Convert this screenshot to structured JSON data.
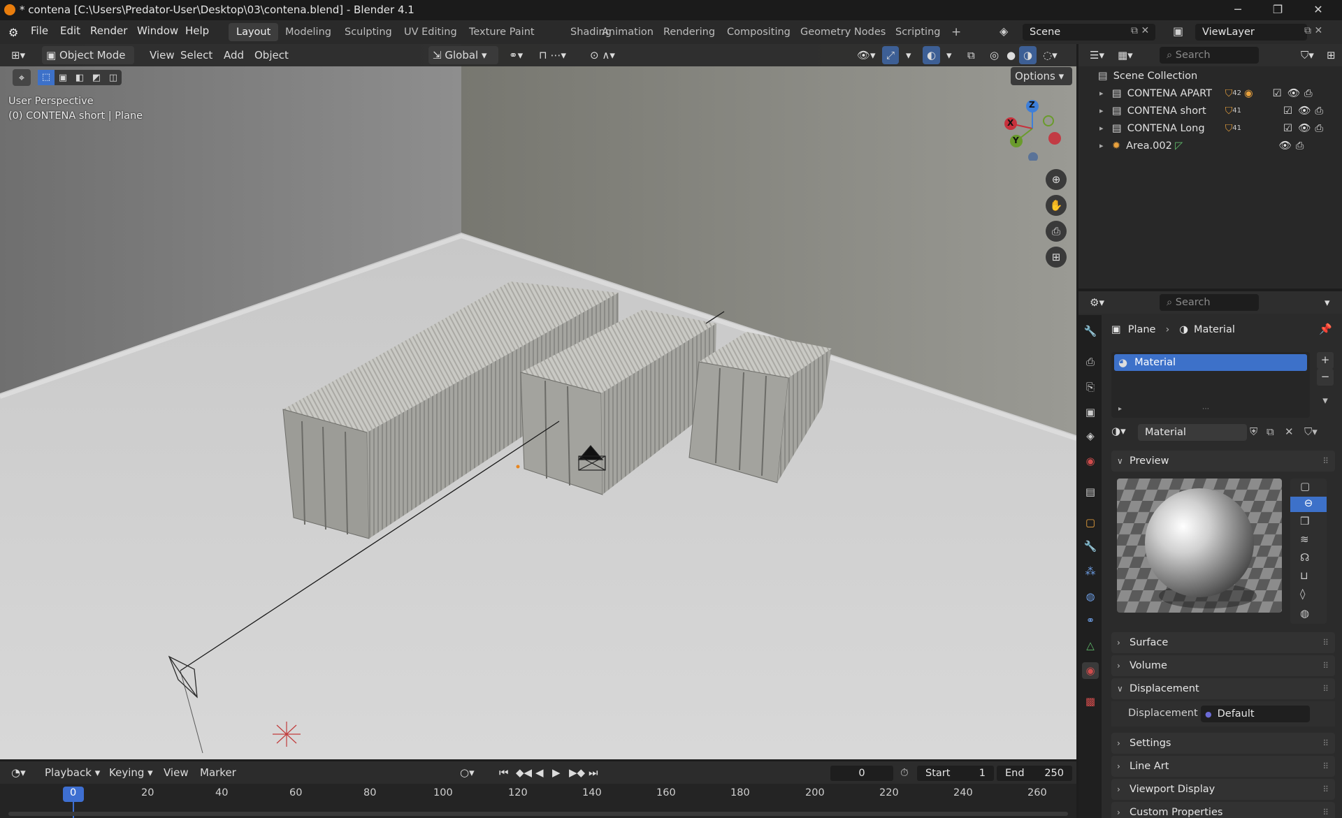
{
  "window": {
    "title": "* contena [C:\\Users\\Predator-User\\Desktop\\03\\contena.blend] - Blender 4.1",
    "minimize": "─",
    "maximize": "❐",
    "close": "✕"
  },
  "menu": {
    "items": [
      "File",
      "Edit",
      "Render",
      "Window",
      "Help"
    ],
    "workspaces": [
      "Layout",
      "Modeling",
      "Sculpting",
      "UV Editing",
      "Texture Paint",
      "Shading",
      "Animation",
      "Rendering",
      "Compositing",
      "Geometry Nodes",
      "Scripting"
    ],
    "active_workspace": "Layout",
    "add_workspace": "+",
    "scene_name": "Scene",
    "view_layer": "ViewLayer"
  },
  "viewport": {
    "mode": "Object Mode",
    "menus": [
      "View",
      "Select",
      "Add",
      "Object"
    ],
    "orientation": "Global",
    "options": "Options",
    "info_line1": "User Perspective",
    "info_line2": "(0) CONTENA short | Plane",
    "gizmo": {
      "z": "Z",
      "x": "X",
      "y": "Y"
    }
  },
  "outliner": {
    "search_placeholder": "Search",
    "root": "Scene Collection",
    "items": [
      {
        "name": "CONTENA APART",
        "badge": "42"
      },
      {
        "name": "CONTENA short",
        "badge": "41"
      },
      {
        "name": "CONTENA Long",
        "badge": "41"
      },
      {
        "name": "Area.002",
        "badge": ""
      }
    ]
  },
  "properties": {
    "search_placeholder": "Search",
    "breadcrumb_object": "Plane",
    "breadcrumb_data": "Material",
    "slot_name": "Material",
    "material_name": "Material",
    "panels": {
      "preview": "Preview",
      "surface": "Surface",
      "volume": "Volume",
      "displacement": "Displacement",
      "displacement_label": "Displacement",
      "displacement_value": "Default",
      "settings": "Settings",
      "line_art": "Line Art",
      "viewport_display": "Viewport Display",
      "custom_properties": "Custom Properties"
    }
  },
  "timeline": {
    "menus": [
      "Playback",
      "Keying",
      "View",
      "Marker"
    ],
    "current_frame": "0",
    "start_label": "Start",
    "start_value": "1",
    "end_label": "End",
    "end_value": "250",
    "ticks": [
      "0",
      "20",
      "40",
      "60",
      "80",
      "100",
      "120",
      "140",
      "160",
      "180",
      "200",
      "220",
      "240",
      "260"
    ]
  },
  "colors": {
    "accent": "#3d71c9",
    "active_frame": "#3e6fd1",
    "x_axis": "#c7313c",
    "y_axis": "#6a9b2c",
    "z_axis": "#3e7fd9"
  }
}
